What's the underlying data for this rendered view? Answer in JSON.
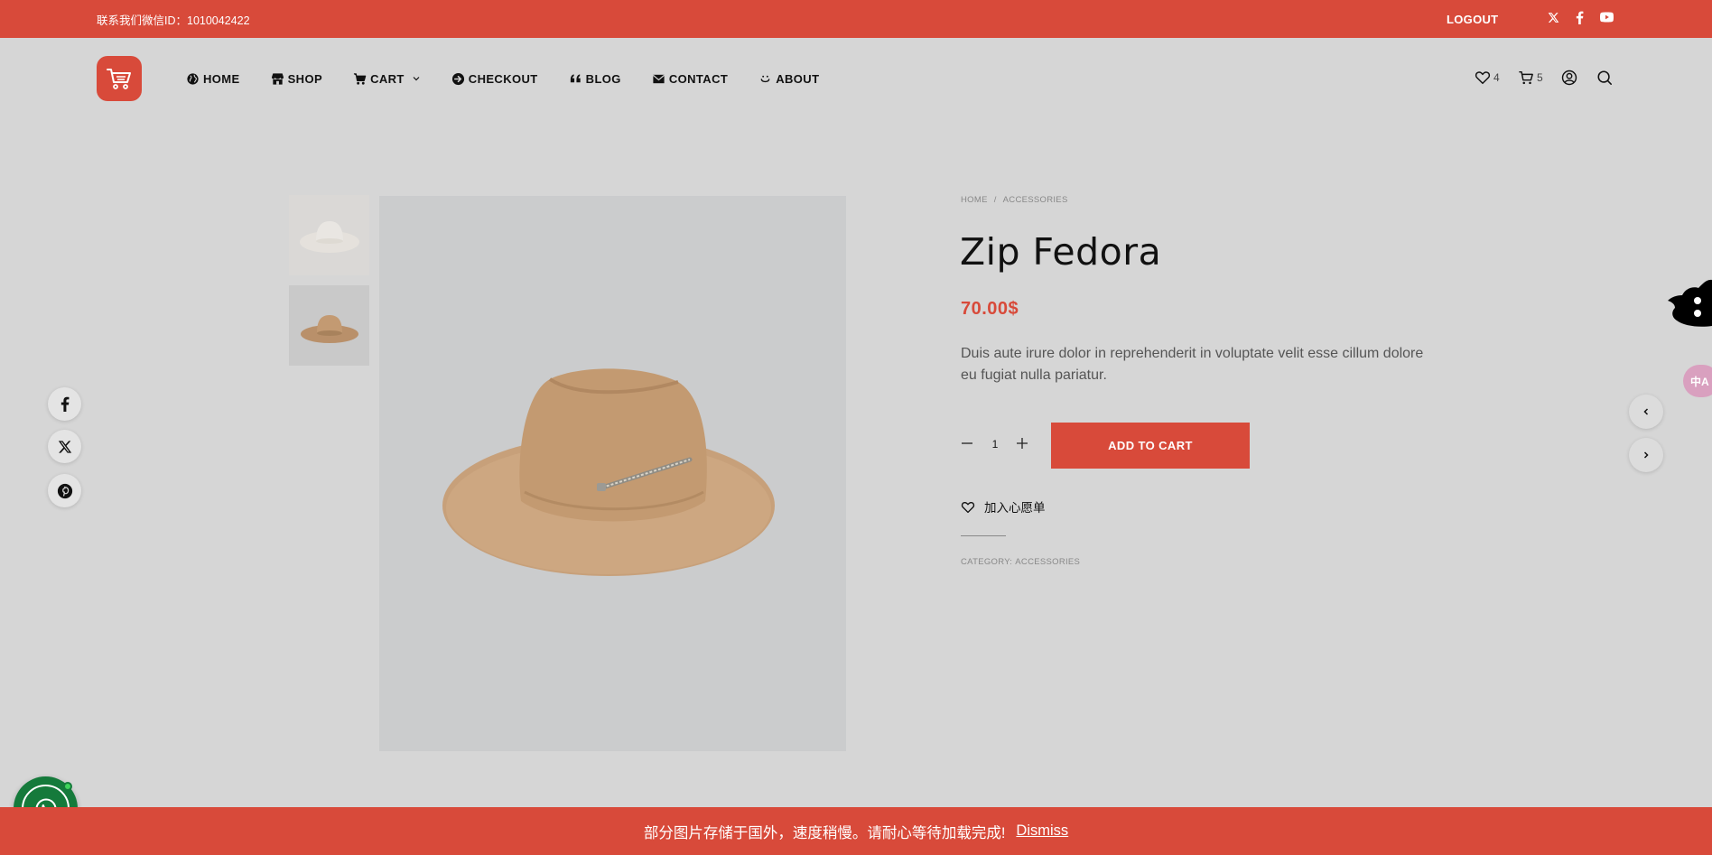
{
  "topbar": {
    "contact": "联系我们微信ID：1010042422",
    "logout": "LOGOUT",
    "social": [
      "x-icon",
      "facebook-icon",
      "youtube-icon"
    ]
  },
  "nav": {
    "home": "HOME",
    "shop": "SHOP",
    "cart": "CART",
    "checkout": "CHECKOUT",
    "blog": "BLOG",
    "contact": "CONTACT",
    "about": "ABOUT"
  },
  "header_icons": {
    "wishlist_count": "4",
    "cart_count": "5"
  },
  "product": {
    "breadcrumb": [
      "HOME",
      "/",
      "ACCESSORIES"
    ],
    "title": "Zip Fedora",
    "price": "70.00$",
    "description": "Duis aute irure dolor in reprehenderit in voluptate velit esse cillum dolore eu fugiat nulla pariatur.",
    "quantity": "1",
    "add_to_cart": "ADD TO CART",
    "wishlist": "加入心愿单",
    "category_label": "CATEGORY:",
    "category_value": "ACCESSORIES"
  },
  "translate": {
    "label": "中A"
  },
  "notice": {
    "text": "部分图片存储于国外，速度稍慢。请耐心等待加载完成!",
    "dismiss": "Dismiss"
  },
  "colors": {
    "accent": "#d84a3a",
    "background": "#d6d6d6",
    "whatsapp": "#157a3b"
  }
}
